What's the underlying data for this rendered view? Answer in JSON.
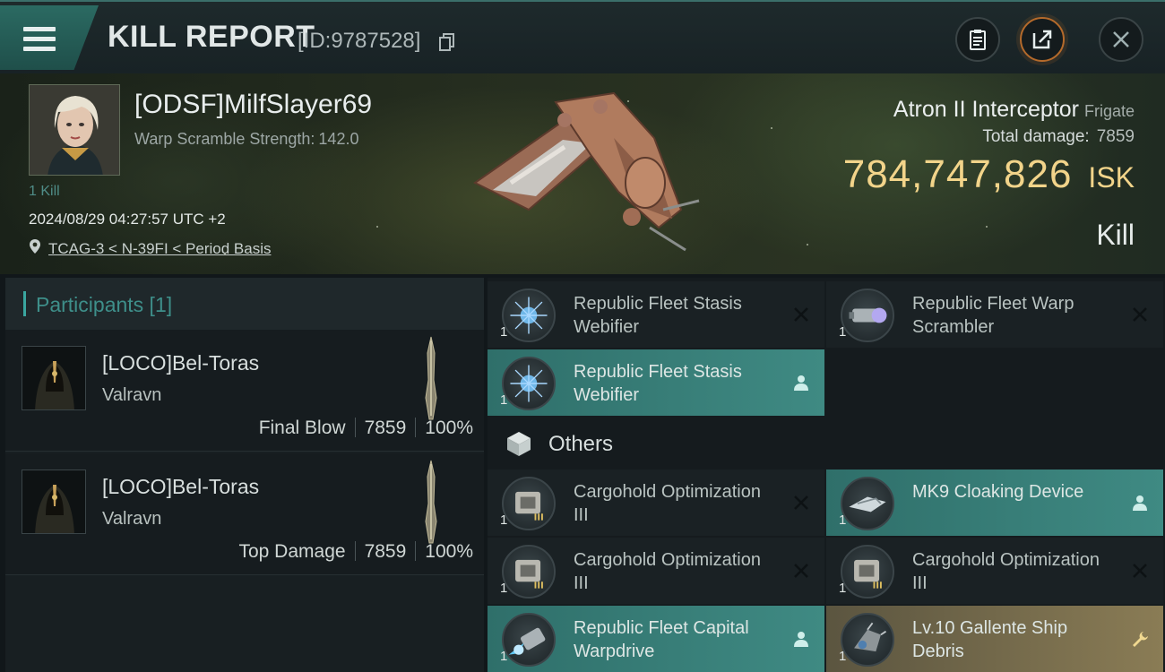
{
  "header": {
    "title": "KILL REPORT",
    "report_id": "[ID:9787528]",
    "icons": [
      "menu-icon",
      "copy-icon",
      "clipboard-icon",
      "share-icon",
      "close-icon"
    ],
    "colors": {
      "accent_teal": "#3aa6a0",
      "isk_gold": "#f2d48a",
      "share_ring": "#b46a2b"
    }
  },
  "victim": {
    "name": "[ODSF]MilfSlayer69",
    "warp_label": "Warp Scramble Strength:",
    "warp_value": "142.0",
    "kill_tag": "1 Kill",
    "datetime": "2024/08/29 04:27:57 UTC +2",
    "location": "TCAG-3 < N-39FI < Period Basis"
  },
  "ship": {
    "name": "Atron II Interceptor",
    "class": "Frigate",
    "damage_label": "Total damage:",
    "damage_value": "7859",
    "isk_value": "784,747,826",
    "isk_unit": "ISK",
    "result": "Kill"
  },
  "participants": {
    "header": "Participants [1]",
    "list": [
      {
        "name": "[LOCO]Bel-Toras",
        "ship": "Valravn",
        "role": "Final Blow",
        "damage": "7859",
        "percent": "100%"
      },
      {
        "name": "[LOCO]Bel-Toras",
        "ship": "Valravn",
        "role": "Top Damage",
        "damage": "7859",
        "percent": "100%"
      }
    ]
  },
  "modules": {
    "top": [
      {
        "qty": "1",
        "name": "Republic Fleet Stasis Webifier",
        "state": "destroyed",
        "icon": "webifier-icon",
        "action_icon": "destroyed-x-icon"
      },
      {
        "qty": "1",
        "name": "Republic Fleet Warp Scrambler",
        "state": "destroyed",
        "icon": "warp-scrambler-icon",
        "action_icon": "destroyed-x-icon"
      },
      {
        "qty": "1",
        "name": "Republic Fleet Stasis Webifier",
        "state": "dropped",
        "icon": "webifier-icon",
        "action_icon": "person-icon"
      }
    ],
    "others_label": "Others",
    "others": [
      {
        "qty": "1",
        "name": "Cargohold Optimization III",
        "state": "destroyed",
        "icon": "cargohold-rig-icon",
        "action_icon": "destroyed-x-icon"
      },
      {
        "qty": "1",
        "name": "MK9 Cloaking Device",
        "state": "dropped",
        "icon": "cloaking-device-icon",
        "action_icon": "person-icon"
      },
      {
        "qty": "1",
        "name": "Cargohold Optimization III",
        "state": "destroyed",
        "icon": "cargohold-rig-icon",
        "action_icon": "destroyed-x-icon"
      },
      {
        "qty": "1",
        "name": "Cargohold Optimization III",
        "state": "destroyed",
        "icon": "cargohold-rig-icon",
        "action_icon": "destroyed-x-icon"
      },
      {
        "qty": "1",
        "name": "Republic Fleet Capital Warpdrive",
        "state": "dropped",
        "icon": "warpdrive-icon",
        "action_icon": "person-icon"
      },
      {
        "qty": "1",
        "name": "Lv.10 Gallente Ship Debris",
        "state": "salvage",
        "icon": "ship-debris-icon",
        "action_icon": "wrench-icon"
      }
    ]
  }
}
